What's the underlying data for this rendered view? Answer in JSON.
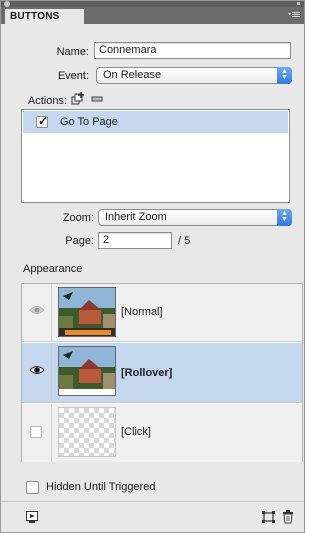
{
  "panel": {
    "tab_label": "BUTTONS",
    "tab_close": "x"
  },
  "form": {
    "name_label": "Name:",
    "name_value": "Connemara",
    "event_label": "Event:",
    "event_value": "On Release",
    "actions_label": "Actions:"
  },
  "actions": [
    {
      "label": "Go To Page",
      "checked": true
    }
  ],
  "zoom": {
    "label": "Zoom:",
    "value": "Inherit Zoom"
  },
  "page": {
    "label": "Page:",
    "value": "2",
    "total": "/ 5"
  },
  "appearance": {
    "heading": "Appearance",
    "states": [
      {
        "label": "[Normal]",
        "bold": false,
        "selected": false,
        "eye_visible": true
      },
      {
        "label": "[Rollover]",
        "bold": true,
        "selected": true,
        "eye_visible": true
      },
      {
        "label": "[Click]",
        "bold": false,
        "selected": false,
        "eye_visible": false
      }
    ]
  },
  "hidden_until_triggered": {
    "label": "Hidden Until Triggered",
    "checked": false
  },
  "colors": {
    "selection": "#c5d8f0",
    "accent": "#2f79de"
  }
}
